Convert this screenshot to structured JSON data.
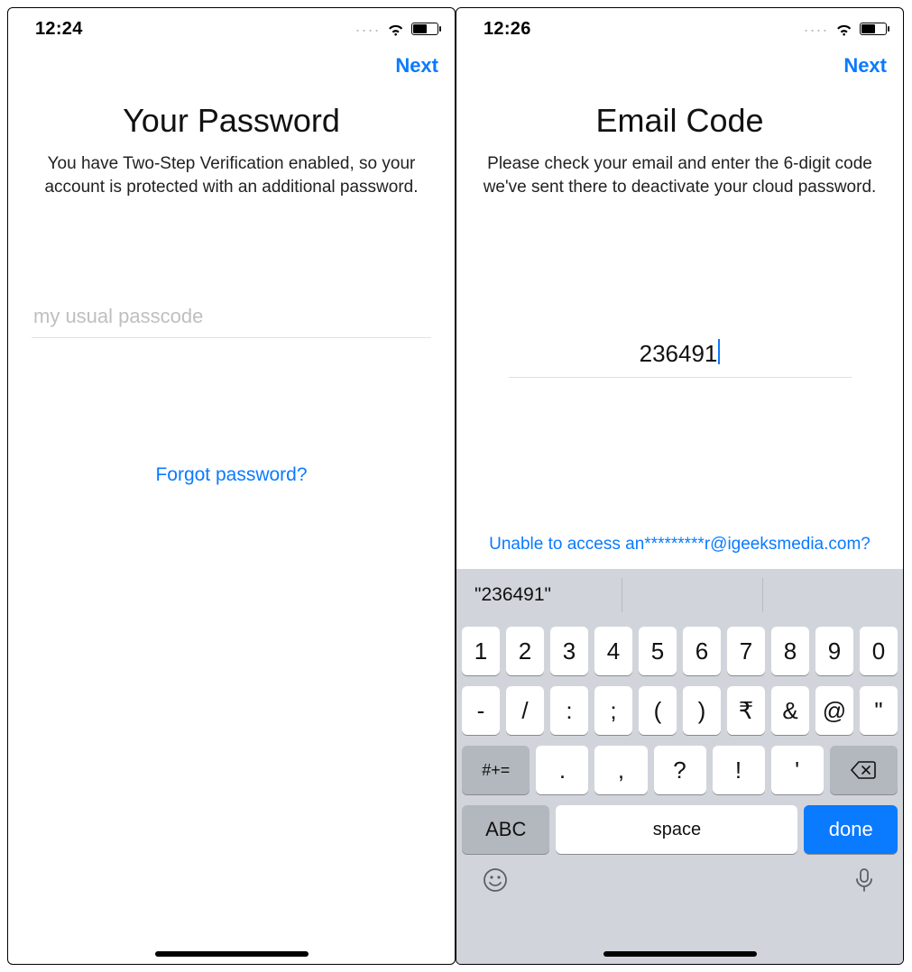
{
  "left": {
    "status_time": "12:24",
    "nav_next": "Next",
    "title": "Your Password",
    "description": "You have Two-Step Verification enabled, so your account is protected with an additional password.",
    "password_placeholder": "my usual passcode",
    "forgot_link": "Forgot password?"
  },
  "right": {
    "status_time": "12:26",
    "nav_next": "Next",
    "title": "Email Code",
    "description": "Please check your email and enter the 6-digit code we've sent there to deactivate your cloud password.",
    "code_value": "236491",
    "help_link": "Unable to access an*********r@igeeksmedia.com?",
    "keyboard": {
      "suggestion": "\"236491\"",
      "row1": [
        "1",
        "2",
        "3",
        "4",
        "5",
        "6",
        "7",
        "8",
        "9",
        "0"
      ],
      "row2": [
        "-",
        "/",
        ":",
        ";",
        "(",
        ")",
        "₹",
        "&",
        "@",
        "\""
      ],
      "row3_shift": "#+=",
      "row3_keys": [
        ".",
        ",",
        "?",
        "!",
        "'"
      ],
      "abc": "ABC",
      "space": "space",
      "done": "done"
    }
  }
}
